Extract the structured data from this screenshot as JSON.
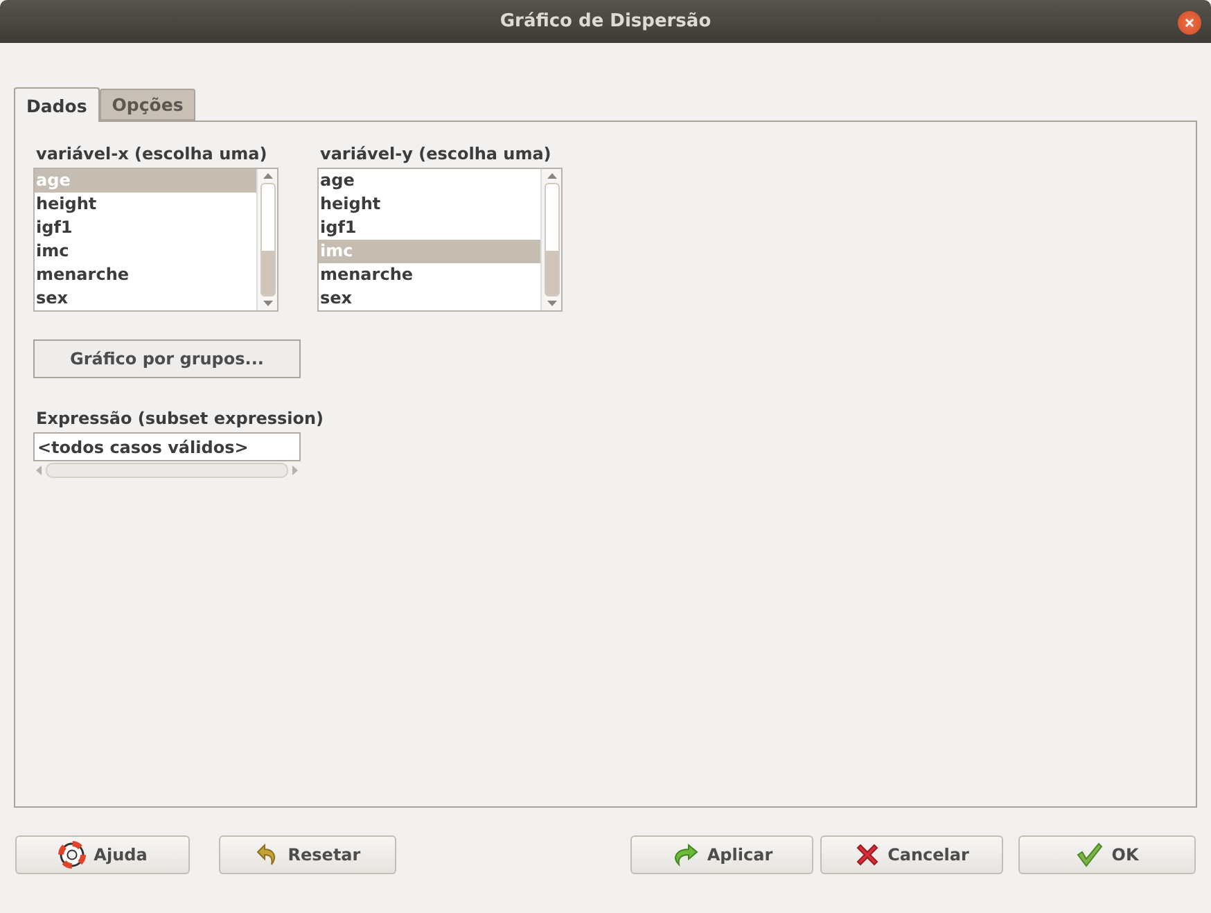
{
  "window": {
    "title": "Gráfico de Dispersão"
  },
  "tabs": [
    {
      "label": "Dados",
      "selected": true
    },
    {
      "label": "Opções",
      "selected": false
    }
  ],
  "x_list": {
    "label": "variável-x (escolha uma)",
    "items": [
      {
        "label": "age",
        "selected": true
      },
      {
        "label": "height",
        "selected": false
      },
      {
        "label": "igf1",
        "selected": false
      },
      {
        "label": "imc",
        "selected": false
      },
      {
        "label": "menarche",
        "selected": false
      },
      {
        "label": "sex",
        "selected": false
      }
    ]
  },
  "y_list": {
    "label": "variável-y (escolha uma)",
    "items": [
      {
        "label": "age",
        "selected": false
      },
      {
        "label": "height",
        "selected": false
      },
      {
        "label": "igf1",
        "selected": false
      },
      {
        "label": "imc",
        "selected": true
      },
      {
        "label": "menarche",
        "selected": false
      },
      {
        "label": "sex",
        "selected": false
      }
    ]
  },
  "groups_button": "Gráfico por grupos...",
  "subset": {
    "label": "Expressão (subset expression)",
    "value": "<todos casos válidos>"
  },
  "buttons": [
    {
      "kind": "help",
      "label": "Ajuda"
    },
    {
      "kind": "reset",
      "label": "Resetar"
    },
    {
      "kind": "apply",
      "label": "Aplicar"
    },
    {
      "kind": "cancel",
      "label": "Cancelar"
    },
    {
      "kind": "ok",
      "label": "OK"
    }
  ]
}
